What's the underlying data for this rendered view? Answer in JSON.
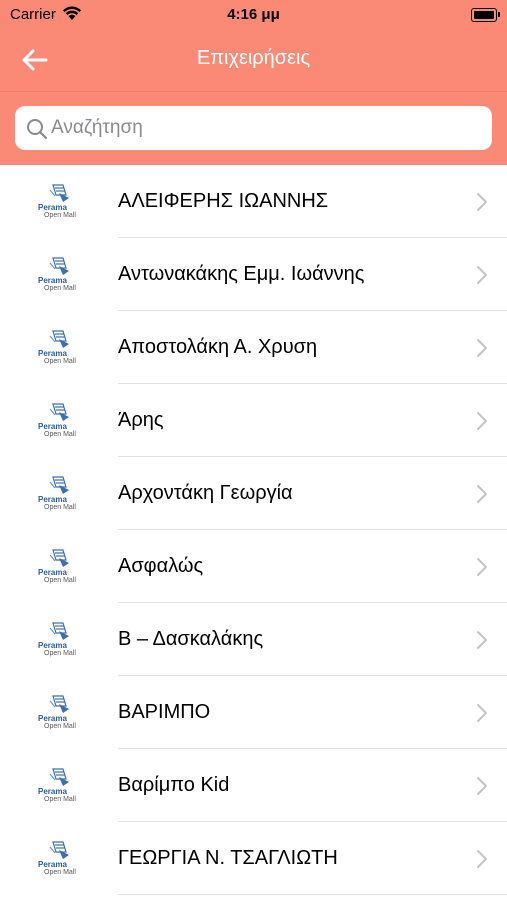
{
  "status": {
    "carrier": "Carrier",
    "time": "4:16 μμ"
  },
  "nav": {
    "title": "Επιχειρήσεις"
  },
  "search": {
    "placeholder": "Αναζήτηση"
  },
  "logo": {
    "line1": "Perama",
    "line2": "Open Mall"
  },
  "colors": {
    "header": "#fa8a76",
    "title": "#ffffff",
    "separator": "#e2e2e4"
  },
  "businesses": [
    "ΑΛΕΙΦΕΡΗΣ ΙΩΑΝΝΗΣ",
    "Αντωνακάκης Εμμ. Ιωάννης",
    "Αποστολάκη Α. Χρυση",
    "Άρης",
    "Αρχοντάκη Γεωργία",
    "Ασφαλώς",
    "Β – Δασκαλάκης",
    "ΒΑΡΙΜΠΟ",
    "Βαρίμπο Kid",
    "ΓΕΩΡΓΙΑ Ν. ΤΣΑΓΛΙΩΤΗ"
  ]
}
